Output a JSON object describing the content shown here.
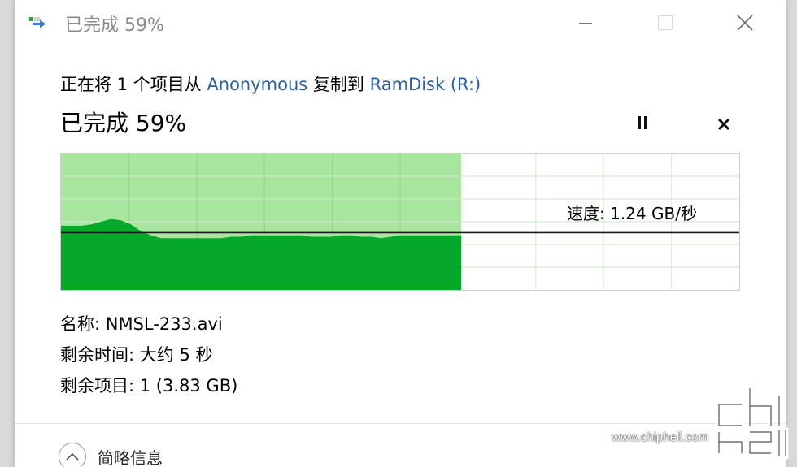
{
  "window": {
    "title": "已完成 59%",
    "icons": {
      "app": "copy-progress-icon",
      "minimize": "minimize-icon",
      "maximize": "maximize-icon",
      "close": "close-icon"
    }
  },
  "operation": {
    "prefix": "正在将 1 个项目从 ",
    "source": "Anonymous",
    "middle": " 复制到 ",
    "destination": "RamDisk (R:)"
  },
  "progress": {
    "label": "已完成 59%",
    "percent": 59,
    "pause_icon": "pause-icon",
    "cancel_icon": "cancel-icon"
  },
  "graph": {
    "speed_label": "速度: 1.24 GB/秒",
    "colors": {
      "completed_area": "#a8e6a0",
      "speed_fill": "#05a82a",
      "speed_line": "#1a1a1a",
      "grid": "#d4ecd0"
    },
    "speed_history_fraction": [
      0.53,
      0.53,
      0.53,
      0.52,
      0.5,
      0.48,
      0.49,
      0.52,
      0.57,
      0.6,
      0.62,
      0.62,
      0.62,
      0.62,
      0.62,
      0.62,
      0.62,
      0.61,
      0.61,
      0.6,
      0.6,
      0.6,
      0.6,
      0.6,
      0.6,
      0.61,
      0.61,
      0.61,
      0.6,
      0.6,
      0.61,
      0.61,
      0.62,
      0.61,
      0.6,
      0.6,
      0.6,
      0.6,
      0.6,
      0.6,
      0.6
    ],
    "current_speed_fraction": 0.58
  },
  "details": {
    "name_label": "名称:",
    "name_value": "NMSL-233.avi",
    "time_label": "剩余时间:",
    "time_value": "大约 5 秒",
    "items_label": "剩余项目:",
    "items_value": "1 (3.83 GB)"
  },
  "footer": {
    "toggle_label": "简略信息",
    "toggle_icon": "chevron-up-icon"
  },
  "watermark": {
    "logo_text": "chip hell",
    "url": "www.chiphell.com"
  }
}
